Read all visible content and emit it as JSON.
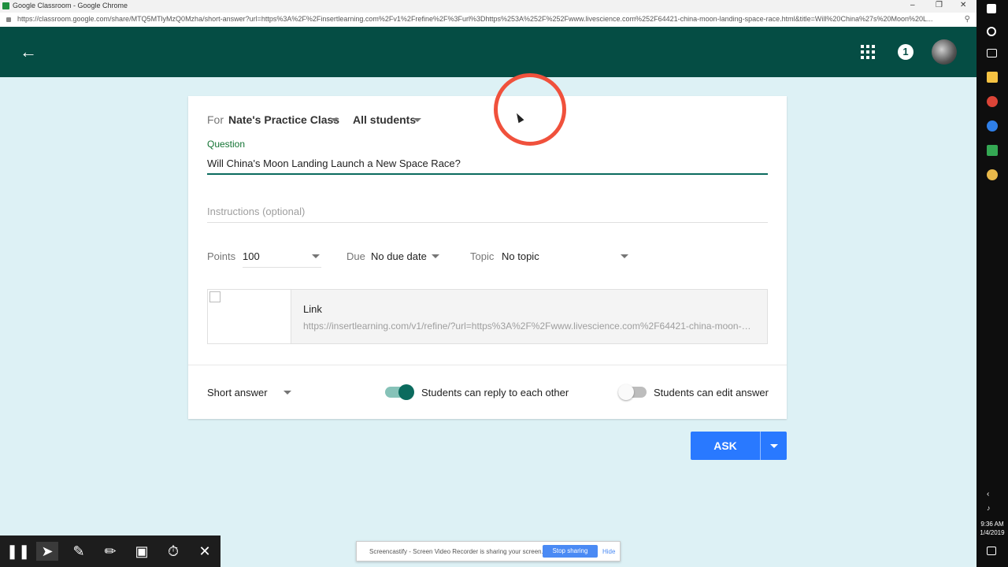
{
  "window": {
    "title": "Google Classroom - Google Chrome",
    "url": "https://classroom.google.com/share/MTQ5MTlyMzQ0Mzha/short-answer?url=https%3A%2F%2Finsertlearning.com%2Fv1%2Frefine%2F%3Furl%3Dhttps%253A%252F%252Fwww.livescience.com%252F64421-china-moon-landing-space-race.html&title=Will%20China%27s%20Moon%20L..."
  },
  "header": {
    "notification_count": "1"
  },
  "form": {
    "for_label": "For",
    "class_name": "Nate's Practice Class",
    "students": "All students",
    "question_label": "Question",
    "question_value": "Will China's Moon Landing Launch a New Space Race?",
    "instructions_placeholder": "Instructions (optional)",
    "points_label": "Points",
    "points_value": "100",
    "due_label": "Due",
    "due_value": "No due date",
    "topic_label": "Topic",
    "topic_value": "No topic"
  },
  "attachment": {
    "title": "Link",
    "url": "https://insertlearning.com/v1/refine/?url=https%3A%2F%2Fwww.livescience.com%2F64421-china-moon-landing-space-race.html"
  },
  "options": {
    "type": "Short answer",
    "reply_label": "Students can reply to each other",
    "reply_on": true,
    "edit_label": "Students can edit answer",
    "edit_on": false
  },
  "actions": {
    "ask_label": "ASK"
  },
  "taskbar": {
    "time": "9:36 AM",
    "date": "1/4/2019"
  },
  "share_banner": {
    "message": "Screencastify - Screen Video Recorder is sharing your screen.",
    "stop_label": "Stop sharing",
    "hide_label": "Hide"
  },
  "colors": {
    "header": "#054d44",
    "accent": "#0b6b5e",
    "button": "#2979ff",
    "background": "#ddf1f5"
  }
}
